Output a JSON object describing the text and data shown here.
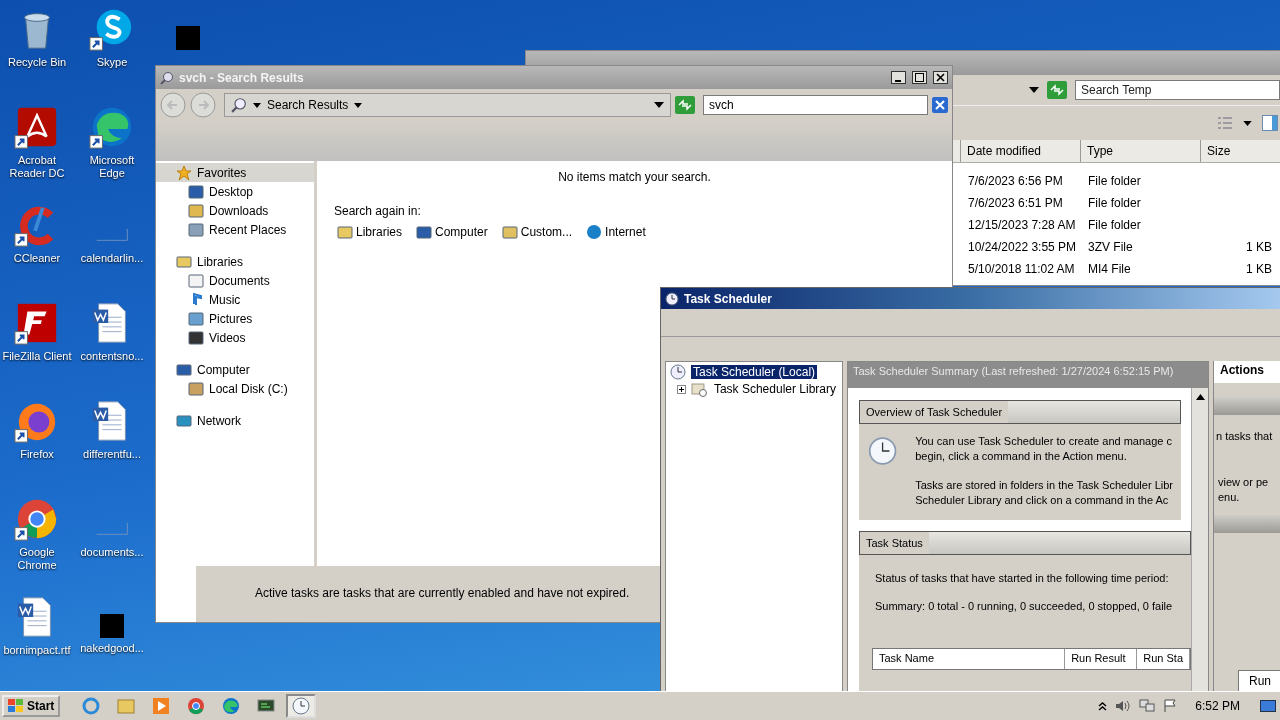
{
  "desktop_icons": [
    {
      "kind": "recycle",
      "label": "Recycle Bin",
      "shortcut": false
    },
    {
      "kind": "acrobat",
      "label": "Acrobat Reader DC",
      "shortcut": true
    },
    {
      "kind": "ccleaner",
      "label": "CCleaner",
      "shortcut": true
    },
    {
      "kind": "filezilla",
      "label": "FileZilla Client",
      "shortcut": true
    },
    {
      "kind": "firefox",
      "label": "Firefox",
      "shortcut": true
    },
    {
      "kind": "chrome",
      "label": "Google Chrome",
      "shortcut": true
    },
    {
      "kind": "word",
      "label": "bornimpact.rtf",
      "shortcut": false
    },
    {
      "kind": "skype",
      "label": "Skype",
      "shortcut": true
    },
    {
      "kind": "edge",
      "label": "Microsoft Edge",
      "shortcut": true
    },
    {
      "kind": "blank",
      "label": "calendarlin...",
      "shortcut": false
    },
    {
      "kind": "word",
      "label": "contentsno...",
      "shortcut": false
    },
    {
      "kind": "word",
      "label": "differentfu...",
      "shortcut": false
    },
    {
      "kind": "blank",
      "label": "documents...",
      "shortcut": false
    },
    {
      "kind": "redacted",
      "label": "nakedgood...",
      "shortcut": false
    },
    {
      "kind": "redacted",
      "shortcut": false
    }
  ],
  "temp_window": {
    "search": {
      "placeholder": "Search Temp"
    },
    "columns": [
      "Date modified",
      "Type",
      "Size"
    ],
    "rows": [
      {
        "date": "7/6/2023 6:56 PM",
        "type": "File folder"
      },
      {
        "date": "7/6/2023 6:51 PM",
        "type": "File folder"
      },
      {
        "date": "12/15/2023 7:28 AM",
        "type": "File folder"
      },
      {
        "date": "10/24/2022 3:55 PM",
        "type": "3ZV File",
        "size": "1 KB"
      },
      {
        "date": "5/10/2018 11:02 AM",
        "type": "MI4 File",
        "size": "1 KB"
      }
    ]
  },
  "search_window": {
    "title": "svch - Search Results",
    "breadcrumb": "Search Results",
    "search": {
      "value": "svch"
    },
    "nav": [
      {
        "label": "Favorites",
        "kind": "star",
        "selected": true,
        "children": [
          {
            "label": "Desktop",
            "kind": "desktop",
            "selected": false
          },
          {
            "label": "Downloads",
            "kind": "download",
            "selected": false
          },
          {
            "label": "Recent Places",
            "kind": "recent",
            "selected": false
          }
        ]
      },
      {
        "label": "Libraries",
        "kind": "library",
        "selected": false,
        "children": [
          {
            "label": "Documents",
            "kind": "document",
            "selected": false
          },
          {
            "label": "Music",
            "kind": "music",
            "selected": false
          },
          {
            "label": "Pictures",
            "kind": "picture",
            "selected": false
          },
          {
            "label": "Videos",
            "kind": "video",
            "selected": false
          }
        ]
      },
      {
        "label": "Computer",
        "kind": "computer",
        "selected": false,
        "children": [
          {
            "label": "Local Disk (C:)",
            "kind": "disk",
            "selected": false
          }
        ]
      },
      {
        "label": "Network",
        "kind": "network",
        "selected": false
      }
    ],
    "message": "No items match your search.",
    "search_again": "Search again in:",
    "locations": [
      {
        "label": "Libraries",
        "kind": "library"
      },
      {
        "label": "Computer",
        "kind": "computer"
      },
      {
        "label": "Custom...",
        "kind": "custom"
      },
      {
        "label": "Internet",
        "kind": "internet"
      }
    ],
    "background_text": "Active tasks are tasks that are currently enabled and have not expired."
  },
  "scheduler": {
    "title": "Task Scheduler",
    "tree": [
      {
        "label": "Task Scheduler (Local)",
        "selected": true
      },
      {
        "label": "Task Scheduler Library",
        "selected": false,
        "expanded": false
      }
    ],
    "summary_header": "Task Scheduler Summary (Last refreshed: 1/27/2024 6:52:15 PM)",
    "overview": {
      "title": "Overview of Task Scheduler",
      "paragraphs": [
        [
          "You can use Task Scheduler to create and manage c",
          "begin, click a command in the Action menu."
        ],
        [
          "Tasks are stored in folders in the Task Scheduler Libr",
          "Scheduler Library and click on a command in the Ac"
        ]
      ]
    },
    "status": {
      "title": "Task Status",
      "period": "Status of tasks that have started in the following time period:",
      "summary": "Summary: 0 total - 0 running, 0 succeeded, 0 stopped, 0 faile",
      "columns": [
        "Task Name",
        "Run Result",
        "Run Sta"
      ]
    },
    "actions": {
      "title": "Actions",
      "fragments": [
        "n tasks that",
        "view or pe",
        "enu."
      ],
      "column": "Run"
    }
  },
  "taskbar": {
    "start": "Start",
    "apps": [
      {
        "kind": "ie",
        "selected": false
      },
      {
        "kind": "explorer",
        "selected": false
      },
      {
        "kind": "media",
        "selected": false
      },
      {
        "kind": "chrome",
        "selected": false
      },
      {
        "kind": "edge",
        "selected": false
      },
      {
        "kind": "terminal",
        "selected": false
      },
      {
        "kind": "clock",
        "selected": true
      }
    ],
    "time": "6:52 PM"
  }
}
